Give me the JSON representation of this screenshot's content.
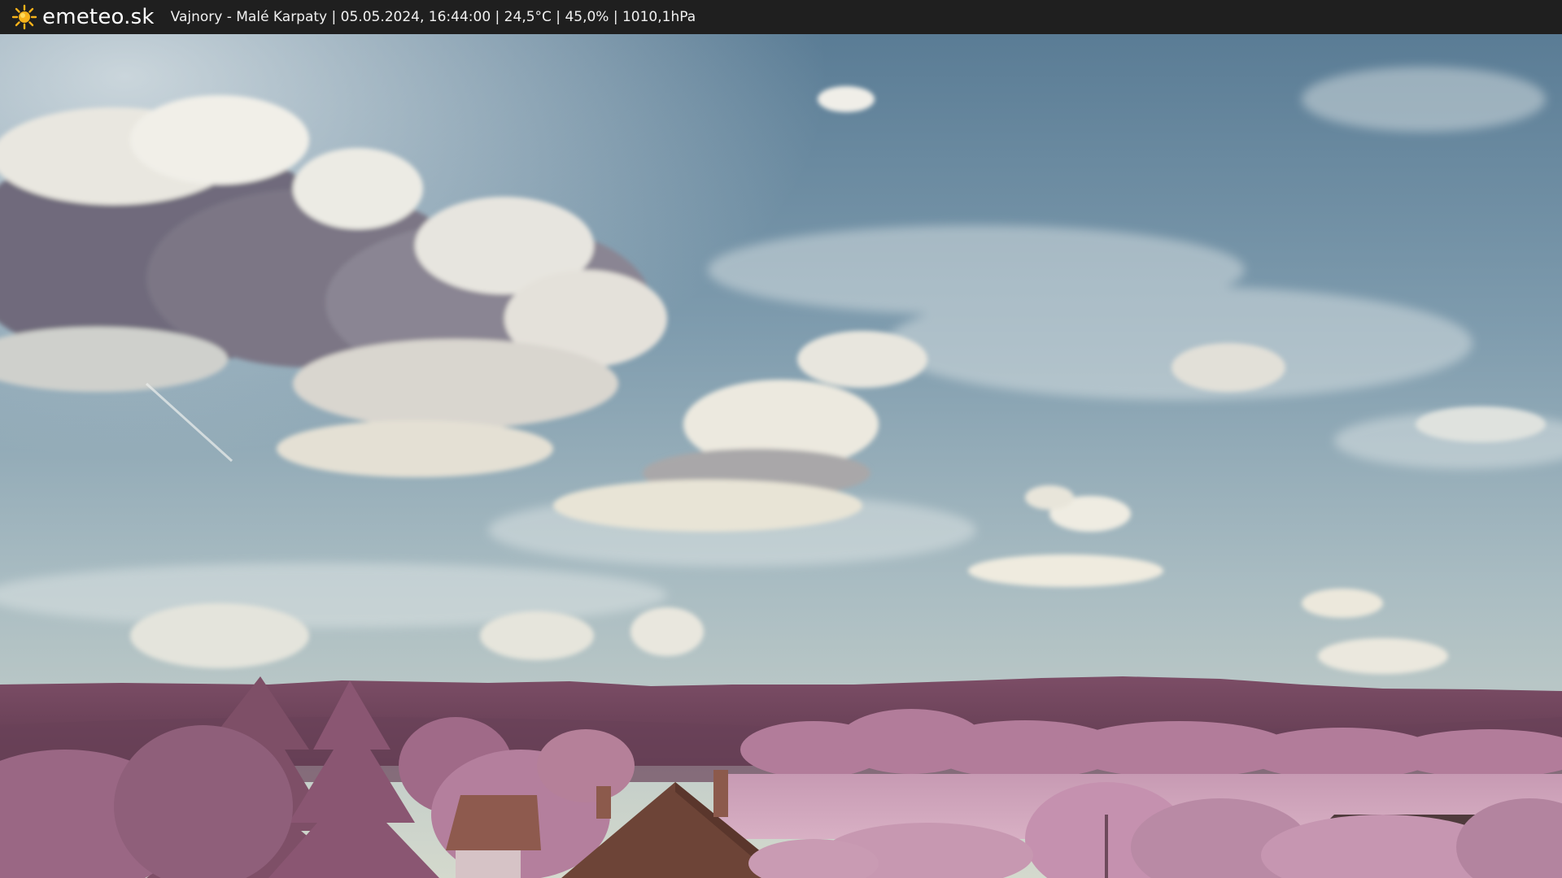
{
  "header": {
    "brand": "emeteo.sk",
    "logo_icon": "sun-icon",
    "caption": "Vajnory - Malé Karpaty | 05.05.2024, 16:44:00 | 24,5°C | 45,0% | 1010,1hPa"
  },
  "scene": {
    "description_icon": "webcam-landscape",
    "colors": {
      "sky_top": "#5f8199",
      "sky_mid": "#9bb3bf",
      "sky_horizon": "#cfd6cc",
      "hills": "#7a4a62",
      "foliage": "#b07a98",
      "roof": "#6e4538"
    }
  }
}
